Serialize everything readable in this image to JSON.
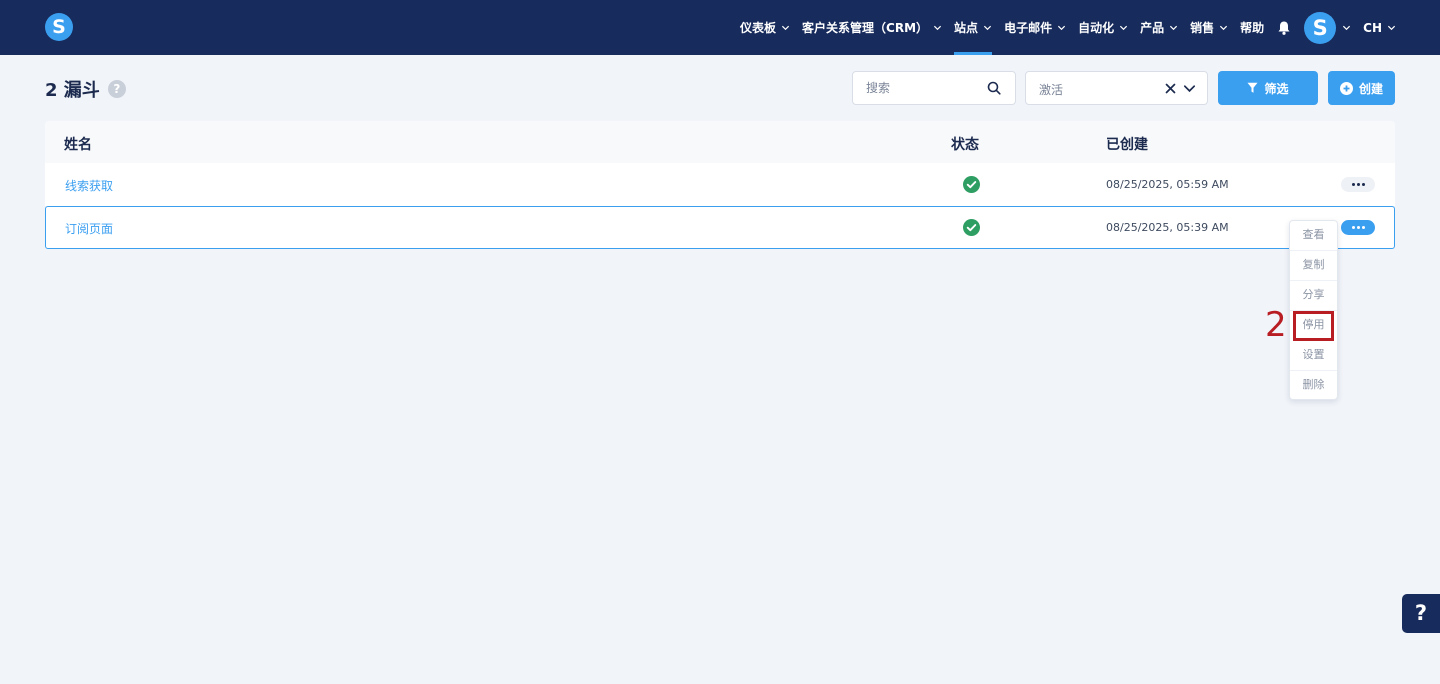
{
  "topbar": {
    "logo_letter": "S",
    "nav": [
      {
        "label": "仪表板",
        "has_dropdown": true,
        "active": false
      },
      {
        "label": "客户关系管理（CRM）",
        "has_dropdown": true,
        "active": false
      },
      {
        "label": "站点",
        "has_dropdown": true,
        "active": true
      },
      {
        "label": "电子邮件",
        "has_dropdown": true,
        "active": false
      },
      {
        "label": "自动化",
        "has_dropdown": true,
        "active": false
      },
      {
        "label": "产品",
        "has_dropdown": true,
        "active": false
      },
      {
        "label": "销售",
        "has_dropdown": true,
        "active": false
      },
      {
        "label": "帮助",
        "has_dropdown": false,
        "active": false
      }
    ],
    "avatar_letter": "S",
    "language": "CH",
    "icons": {
      "notifications": "bell-icon"
    }
  },
  "page": {
    "title": "2 漏斗",
    "help_glyph": "?"
  },
  "toolbar": {
    "search_placeholder": "搜索",
    "status_filter_value": "激活",
    "filter_label": "筛选",
    "create_label": "创建"
  },
  "table": {
    "columns": [
      "姓名",
      "状态",
      "已创建"
    ],
    "rows": [
      {
        "name": "线索获取",
        "status": "active",
        "created": "08/25/2025, 05:59 AM",
        "selected": false
      },
      {
        "name": "订阅页面",
        "status": "active",
        "created": "08/25/2025, 05:39 AM",
        "selected": true
      }
    ]
  },
  "context_menu": {
    "items": [
      "查看",
      "复制",
      "分享",
      "停用",
      "设置",
      "删除"
    ],
    "highlighted": "停用"
  },
  "annotation": {
    "label": "2"
  },
  "help_fab": {
    "glyph": "?"
  },
  "colors": {
    "nav_bg": "#172b5c",
    "accent": "#3b9ff0",
    "page_bg": "#f1f4f9",
    "success": "#2f9e63",
    "annotation": "#b81d24"
  }
}
